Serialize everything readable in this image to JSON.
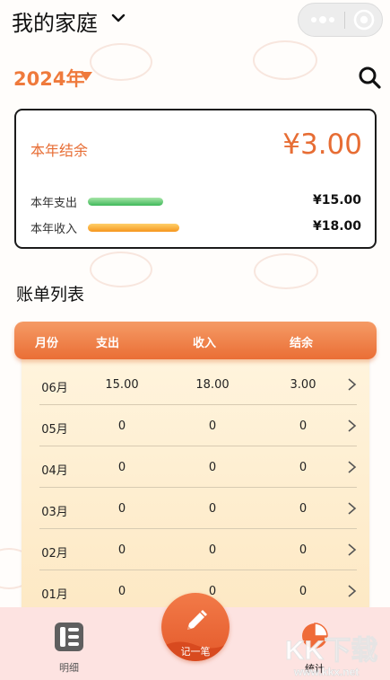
{
  "header": {
    "title": "我的家庭"
  },
  "year": {
    "label": "2024年"
  },
  "summary": {
    "balance_label": "本年结余",
    "balance_value": "¥3.00",
    "expense_label": "本年支出",
    "expense_value": "¥15.00",
    "income_label": "本年收入",
    "income_value": "¥18.00",
    "colors": {
      "accent": "#e76d34",
      "expense_bar": "#3fb95a",
      "income_bar": "#f6961e"
    }
  },
  "list": {
    "title": "账单列表",
    "columns": [
      "月份",
      "支出",
      "收入",
      "结余"
    ],
    "rows": [
      {
        "month": "06月",
        "expense": "15.00",
        "income": "18.00",
        "balance": "3.00"
      },
      {
        "month": "05月",
        "expense": "0",
        "income": "0",
        "balance": "0"
      },
      {
        "month": "04月",
        "expense": "0",
        "income": "0",
        "balance": "0"
      },
      {
        "month": "03月",
        "expense": "0",
        "income": "0",
        "balance": "0"
      },
      {
        "month": "02月",
        "expense": "0",
        "income": "0",
        "balance": "0"
      },
      {
        "month": "01月",
        "expense": "0",
        "income": "0",
        "balance": "0"
      }
    ]
  },
  "nav": {
    "detail_label": "明细",
    "record_label": "记一笔",
    "stats_label": "统计"
  },
  "watermark": {
    "text": "KK下载",
    "url": "www.kkx.net"
  }
}
